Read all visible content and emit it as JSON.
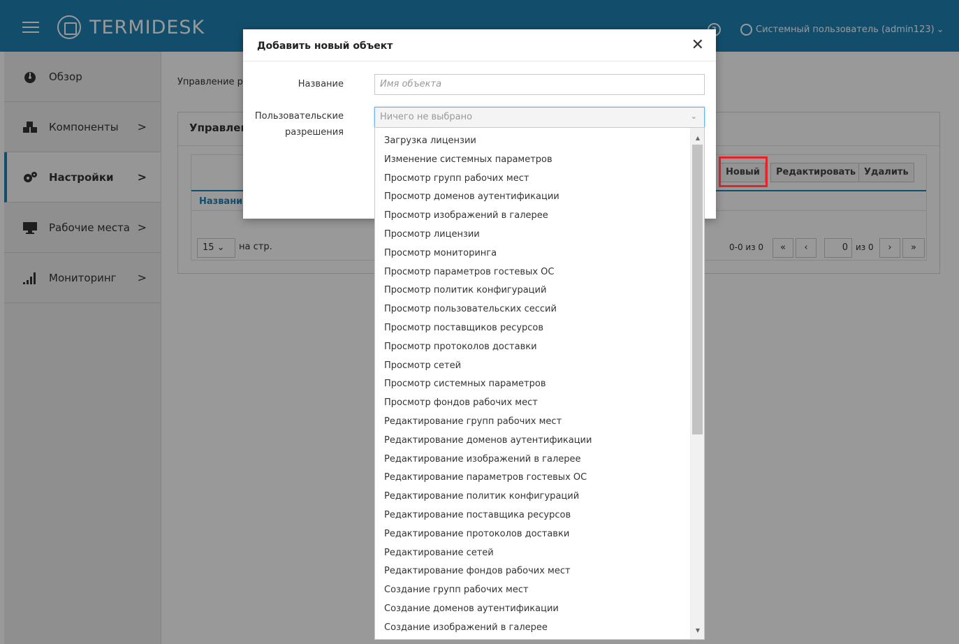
{
  "header": {
    "logo_text": "TERMIDESK",
    "user_label": "Системный пользователь (admin123)",
    "user_caret": "⌄",
    "help_glyph": "?"
  },
  "sidebar": {
    "items": [
      {
        "label": "Обзор",
        "icon": "dashboard-icon",
        "chevron": ""
      },
      {
        "label": "Компоненты",
        "icon": "cubes-icon",
        "chevron": ">"
      },
      {
        "label": "Настройки",
        "icon": "gears-icon",
        "chevron": ">"
      },
      {
        "label": "Рабочие места",
        "icon": "desktop-icon",
        "chevron": ">"
      },
      {
        "label": "Мониторинг",
        "icon": "bar-chart-icon",
        "chevron": ">"
      }
    ],
    "active_index": 2
  },
  "page": {
    "breadcrumb": "Управление р",
    "panel_title": "Управлен",
    "column_name": "Названи",
    "buttons": {
      "new": "Новый",
      "edit": "Редактировать",
      "delete": "Удалить"
    },
    "per_page_value": "15 ⌄",
    "per_page_label": "на стр.",
    "range_text": "0-0 из 0",
    "first_glyph": "«",
    "prev_glyph": "‹",
    "page_value": "0",
    "page_of": "из 0",
    "next_glyph": "›",
    "last_glyph": "»"
  },
  "modal": {
    "title": "Добавить новый объект",
    "close_glyph": "✕",
    "name_label": "Название",
    "name_placeholder": "Имя объекта",
    "perm_label_1": "Пользовательские",
    "perm_label_2": "разрешения",
    "perm_selected": "Ничего не выбрано",
    "perm_caret": "⌄"
  },
  "dropdown": {
    "scroll_up": "▲",
    "scroll_down": "▼",
    "options": [
      "Загрузка лицензии",
      "Изменение системных параметров",
      "Просмотр групп рабочих мест",
      "Просмотр доменов аутентификации",
      "Просмотр изображений в галерее",
      "Просмотр лицензии",
      "Просмотр мониторинга",
      "Просмотр параметров гостевых ОС",
      "Просмотр политик конфигураций",
      "Просмотр пользовательских сессий",
      "Просмотр поставщиков ресурсов",
      "Просмотр протоколов доставки",
      "Просмотр сетей",
      "Просмотр системных параметров",
      "Просмотр фондов рабочих мест",
      "Редактирование групп рабочих мест",
      "Редактирование доменов аутентификации",
      "Редактирование изображений в галерее",
      "Редактирование параметров гостевых ОС",
      "Редактирование политик конфигураций",
      "Редактирование поставщика ресурсов",
      "Редактирование протоколов доставки",
      "Редактирование сетей",
      "Редактирование фондов рабочих мест",
      "Создание групп рабочих мест",
      "Создание доменов аутентификации",
      "Создание изображений в галерее"
    ]
  },
  "colors": {
    "brand": "#1f82b4",
    "highlight": "#e3242b"
  }
}
